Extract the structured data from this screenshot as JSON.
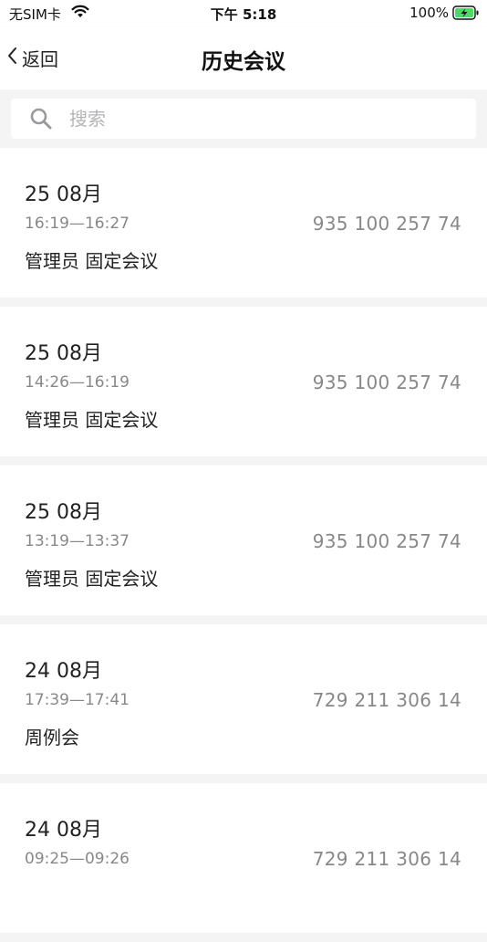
{
  "status_bar": {
    "carrier": "无SIM卡",
    "time": "下午 5:18",
    "battery": "100%"
  },
  "nav": {
    "back_label": "返回",
    "title": "历史会议"
  },
  "search": {
    "placeholder": "搜索"
  },
  "meetings": [
    {
      "date": "25 08月",
      "time_range": "16:19—16:27",
      "meeting_id": "935 100 257 74",
      "name": "管理员 固定会议"
    },
    {
      "date": "25 08月",
      "time_range": "14:26—16:19",
      "meeting_id": "935 100 257 74",
      "name": "管理员 固定会议"
    },
    {
      "date": "25 08月",
      "time_range": "13:19—13:37",
      "meeting_id": "935 100 257 74",
      "name": "管理员 固定会议"
    },
    {
      "date": "24 08月",
      "time_range": "17:39—17:41",
      "meeting_id": "729 211 306 14",
      "name": "周例会"
    },
    {
      "date": "24 08月",
      "time_range": "09:25—09:26",
      "meeting_id": "729 211 306 14",
      "name": ""
    }
  ]
}
